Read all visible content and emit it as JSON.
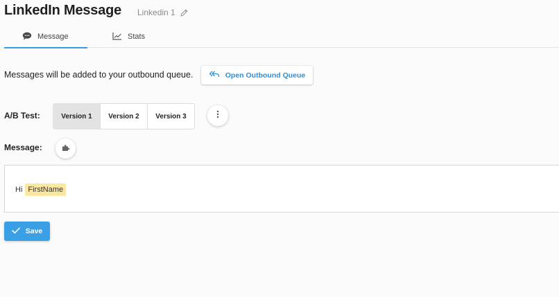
{
  "header": {
    "title": "LinkedIn Message",
    "subtitle": "Linkedin 1",
    "edit_icon": "pencil-icon"
  },
  "tabs": [
    {
      "label": "Message",
      "icon": "chat-bubble-icon",
      "active": true
    },
    {
      "label": "Stats",
      "icon": "line-chart-icon",
      "active": false
    }
  ],
  "queue": {
    "text": "Messages will be added to your outbound queue.",
    "button_label": "Open Outbound Queue",
    "button_icon": "reply-arrows-icon"
  },
  "ab_test": {
    "label": "A/B Test:",
    "versions": [
      "Version 1",
      "Version 2",
      "Version 3"
    ],
    "selected": "Version 1",
    "more_icon": "vertical-dots-icon"
  },
  "message": {
    "label": "Message:",
    "plugin_icon": "puzzle-icon",
    "body_text": "Hi",
    "merge_tag": "FirstName"
  },
  "save": {
    "label": "Save",
    "icon": "checkmark-icon"
  },
  "colors": {
    "accent": "#3aa0e6",
    "link": "#2e8fd6",
    "merge_tag_bg": "#fbe7a1",
    "selected_version_bg": "#e3e3e3"
  }
}
